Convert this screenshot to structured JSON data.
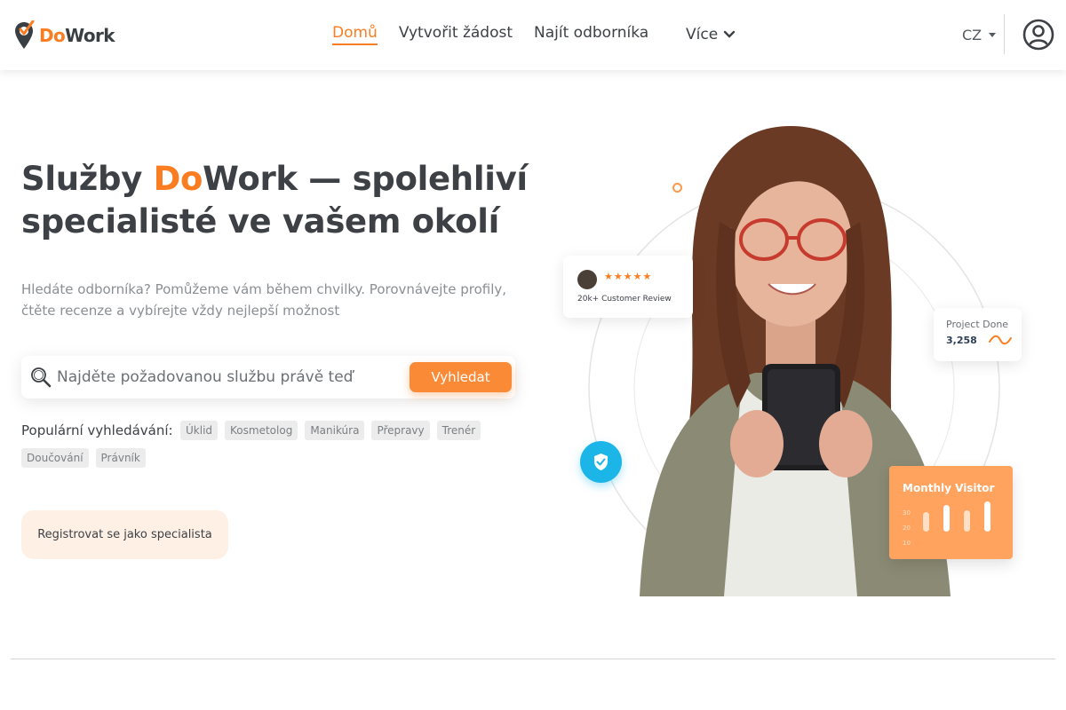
{
  "brand": {
    "do": "Do",
    "work": "Work",
    "accent_color": "#fb7d21"
  },
  "nav": {
    "links": [
      "Domů",
      "Vytvořit žádost",
      "Najít odborníka"
    ],
    "active_index": 0,
    "more_label": "Více",
    "lang": "CZ"
  },
  "hero": {
    "title_pre": "Služby ",
    "title_accent": "Do",
    "title_post": "Work — spolehliví specialisté ve vašem okolí",
    "subtitle": "Hledáte odborníka? Pomůžeme vám během chvilky. Porovnávejte profily, čtěte recenze a vybírejte vždy nejlepší možnost",
    "search_placeholder": "Najděte požadovanou službu právě teď",
    "search_button": "Vyhledat",
    "popular_label": "Populární vyhledávání:",
    "popular_tags_row1": [
      "Úklid",
      "Kosmetolog",
      "Manikúra",
      "Přepravy",
      "Trenér"
    ],
    "popular_tags_row2": [
      "Doučování",
      "Právník"
    ],
    "register_button": "Registrovat se jako specialista"
  },
  "illustration": {
    "review_text": "20k+ Customer Review",
    "review_stars": "★★★★★",
    "project_title": "Project Done",
    "project_value": "3,258",
    "visitor_title": "Monthly Visitor",
    "visitor_ticks": [
      "30",
      "20",
      "10"
    ],
    "visitor_bars": [
      0.55,
      0.75,
      0.6,
      0.85
    ],
    "badge_color": "#1cb5e8",
    "visitor_color": "#ffa35e"
  }
}
